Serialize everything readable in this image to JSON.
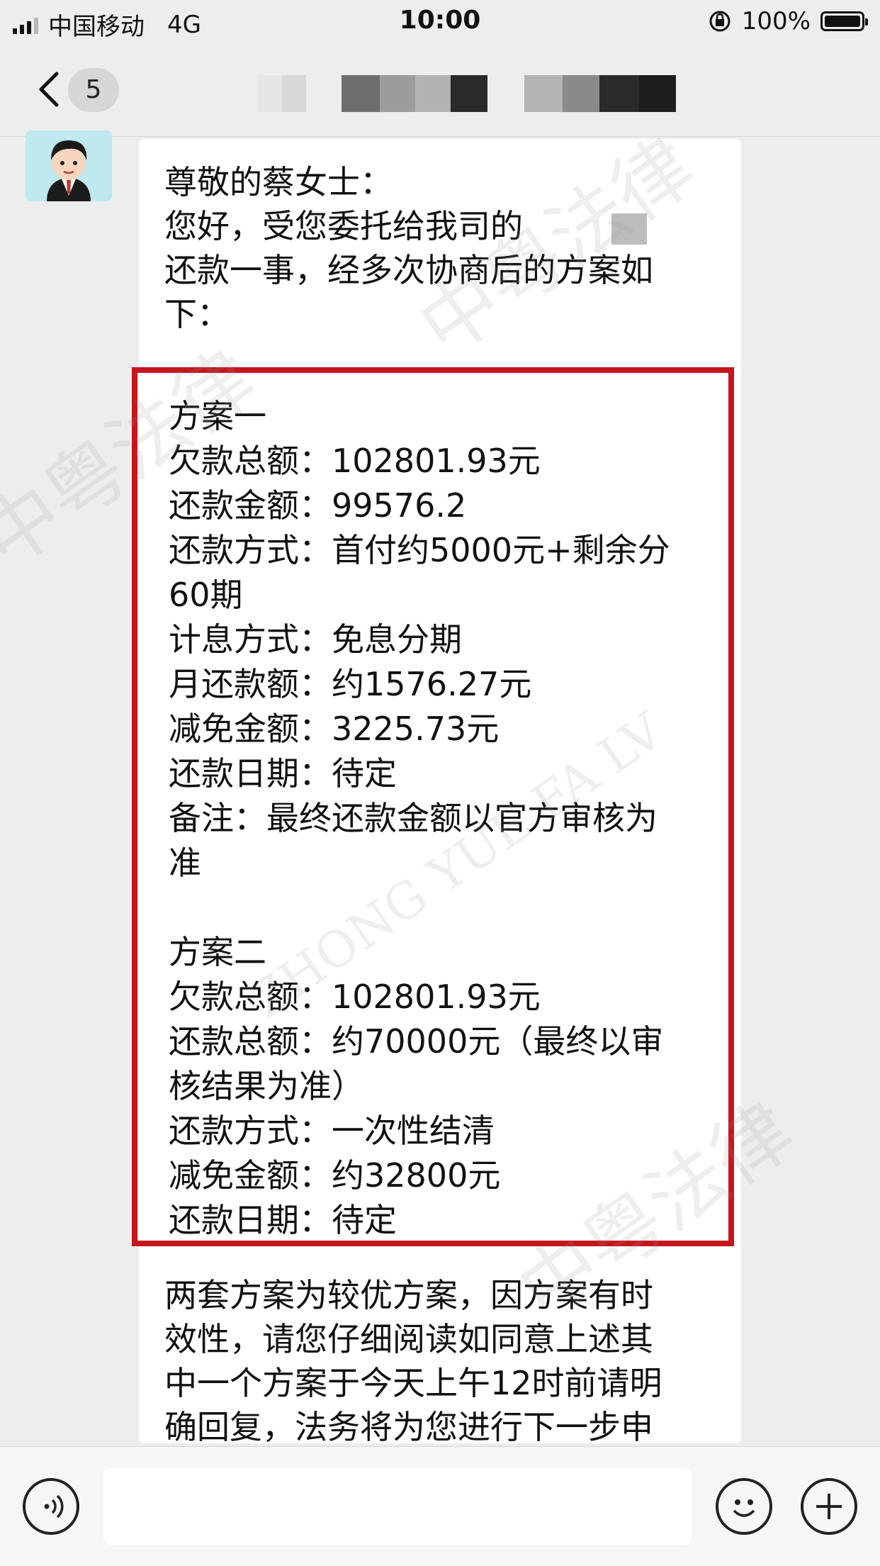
{
  "status_bar": {
    "carrier": "中国移动",
    "network": "4G",
    "time": "10:00",
    "battery": "100%"
  },
  "nav": {
    "unread_count": "5"
  },
  "message": {
    "greeting": "尊敬的蔡女士：",
    "intro_line1": "您好，受您委托给我司的",
    "intro_line2": "还款一事，经多次协商后的方案如",
    "intro_line3": "下：",
    "plan1": {
      "title": "方案一",
      "rows": [
        {
          "label": "欠款总额：",
          "value": "102801.93元"
        },
        {
          "label": "还款金额：",
          "value": "99576.2"
        },
        {
          "label": "还款方式：",
          "value": "首付约5000元+剩余分"
        },
        {
          "label": "",
          "value": "60期"
        },
        {
          "label": "计息方式：",
          "value": "免息分期"
        },
        {
          "label": "月还款额：",
          "value": "约1576.27元"
        },
        {
          "label": "减免金额：",
          "value": "3225.73元"
        },
        {
          "label": "还款日期：",
          "value": "待定"
        },
        {
          "label": "备注：",
          "value": "最终还款金额以官方审核为"
        },
        {
          "label": "",
          "value": "准"
        }
      ]
    },
    "plan2": {
      "title": "方案二",
      "rows": [
        {
          "label": "欠款总额：",
          "value": "102801.93元"
        },
        {
          "label": "还款总额：",
          "value": "约70000元（最终以审"
        },
        {
          "label": "",
          "value": "核结果为准）"
        },
        {
          "label": "还款方式：",
          "value": "一次性结清"
        },
        {
          "label": "减免金额：",
          "value": "约32800元"
        },
        {
          "label": "还款日期：",
          "value": "待定"
        }
      ]
    },
    "closing_lines": [
      "两套方案为较优方案，因方案有时",
      "效性，请您仔细阅读如同意上述其",
      "中一个方案于今天上午12时前请明",
      "确回复，法务将为您进行下一步申"
    ]
  },
  "watermark": {
    "text_cn": "中粤法律",
    "text_en": "ZHONG YUE FA LV"
  }
}
